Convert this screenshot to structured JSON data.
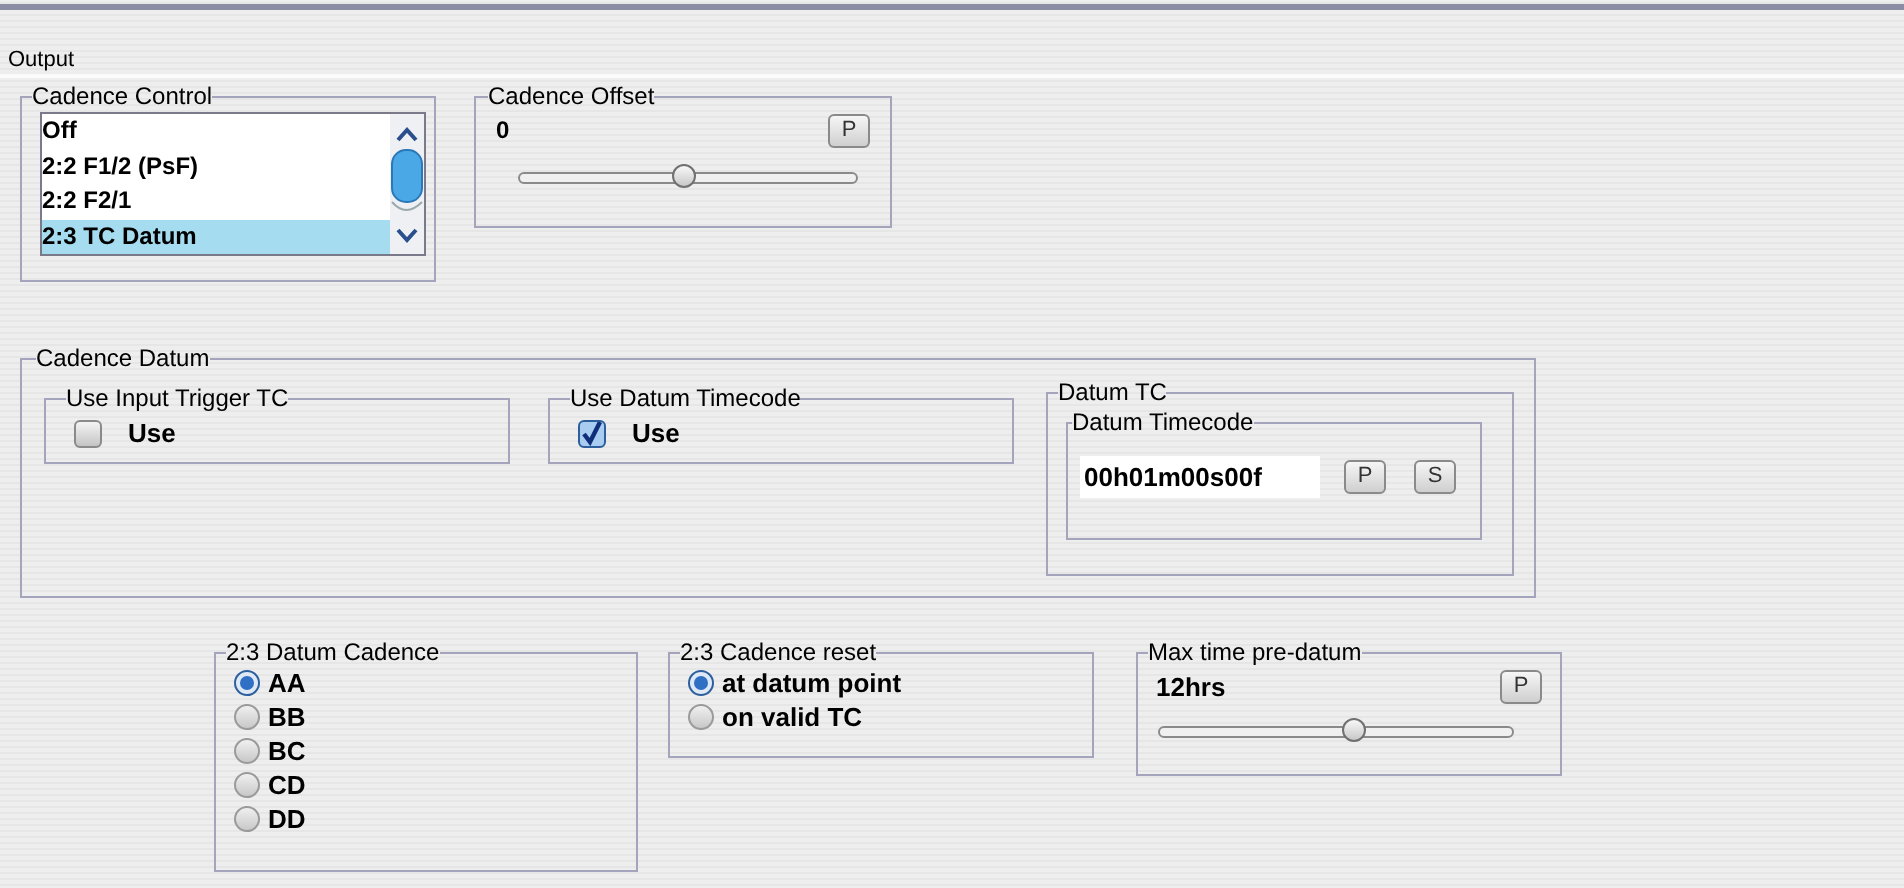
{
  "panel_title": "Output",
  "cadence_control": {
    "title": "Cadence Control",
    "items": [
      {
        "label": "Off",
        "selected": false
      },
      {
        "label": "2:2 F1/2 (PsF)",
        "selected": false
      },
      {
        "label": "2:2 F2/1",
        "selected": false
      },
      {
        "label": "2:3 TC Datum",
        "selected": true
      }
    ]
  },
  "cadence_offset": {
    "title": "Cadence Offset",
    "value": "0",
    "button": "P",
    "level": 0.49
  },
  "cadence_datum": {
    "title": "Cadence Datum",
    "toggles": [
      {
        "title": "Use Input Trigger TC",
        "label": "Use",
        "checked": false
      },
      {
        "title": "Use Datum Timecode",
        "label": "Use",
        "checked": true
      }
    ],
    "datum_tc": {
      "title": "Datum TC",
      "inner_title": "Datum Timecode",
      "value": "00h01m00s00f",
      "buttons": [
        "P",
        "S"
      ]
    }
  },
  "datum_cadence": {
    "title": "2:3 Datum Cadence",
    "options": [
      {
        "label": "AA",
        "selected": true
      },
      {
        "label": "BB",
        "selected": false
      },
      {
        "label": "BC",
        "selected": false
      },
      {
        "label": "CD",
        "selected": false
      },
      {
        "label": "DD",
        "selected": false
      }
    ]
  },
  "cadence_reset": {
    "title": "2:3 Cadence reset",
    "options": [
      {
        "label": "at datum point",
        "selected": true
      },
      {
        "label": "on valid TC",
        "selected": false
      }
    ]
  },
  "max_time": {
    "title": "Max time pre-datum",
    "value": "12hrs",
    "button": "P",
    "level": 0.55
  }
}
